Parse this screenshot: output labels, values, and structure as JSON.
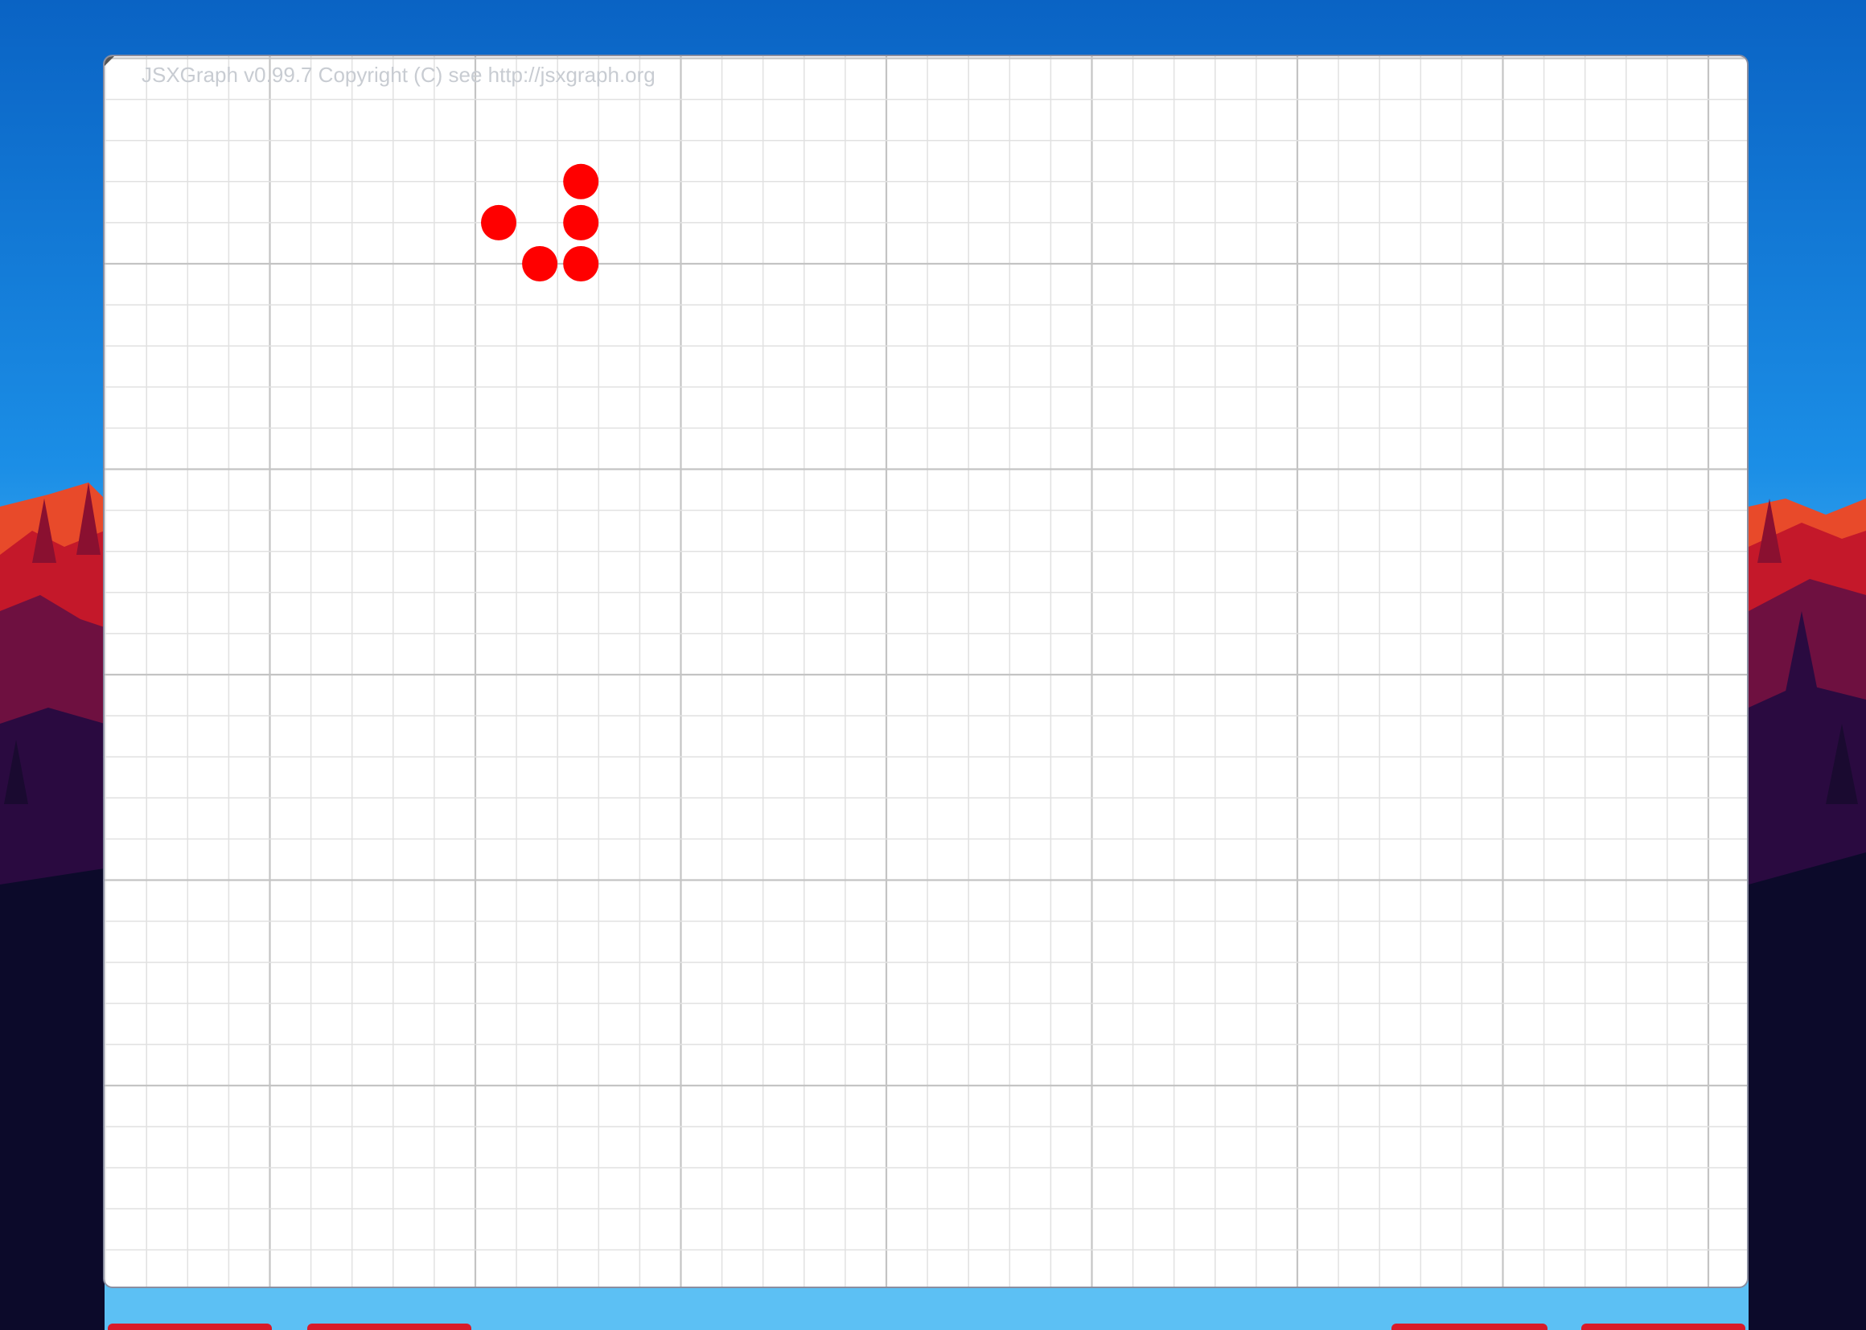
{
  "board": {
    "copyright_text": "JSXGraph v0.99.7 Copyright (C) see http://jsxgraph.org",
    "point_color": "#ff0000",
    "points": [
      {
        "x": 9,
        "y": 2
      },
      {
        "x": 7,
        "y": 1
      },
      {
        "x": 9,
        "y": 1
      },
      {
        "x": 8,
        "y": 0
      },
      {
        "x": 9,
        "y": 0
      }
    ]
  },
  "colors": {
    "sky_top": "#0a63c4",
    "sky_bottom": "#5cc0f4",
    "grid_minor": "#e1e1e1",
    "grid_major": "#c4c4c4"
  }
}
